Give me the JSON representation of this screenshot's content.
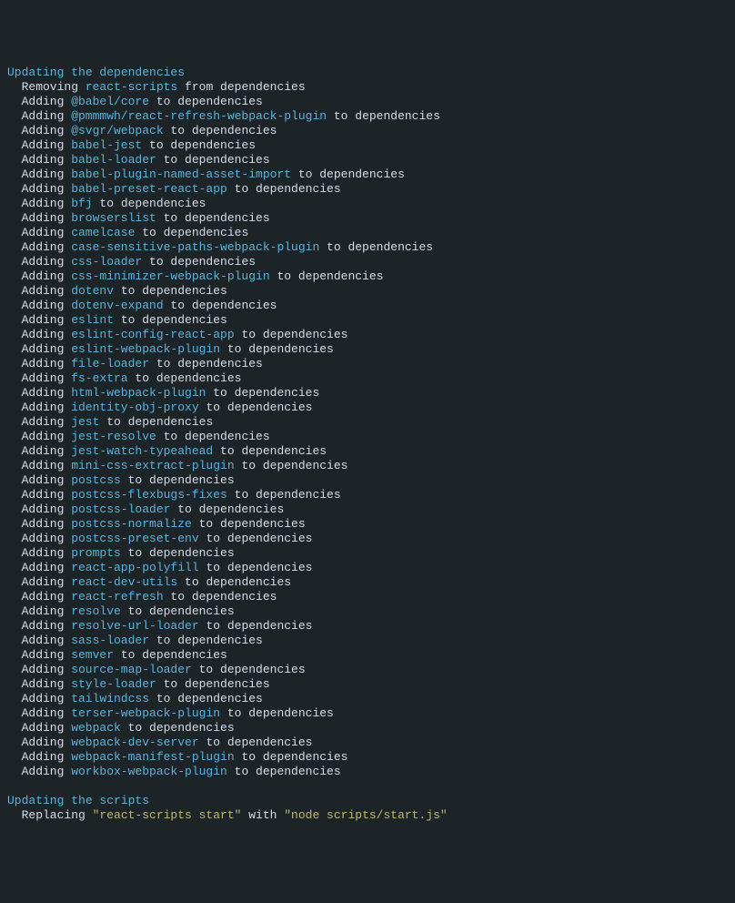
{
  "deps": {
    "header": "Updating the dependencies",
    "removing_verb": "Removing",
    "removing_pkg": "react-scripts",
    "removing_target": "from dependencies",
    "adding_verb": "Adding",
    "adding_target": "to dependencies",
    "packages": [
      "@babel/core",
      "@pmmmwh/react-refresh-webpack-plugin",
      "@svgr/webpack",
      "babel-jest",
      "babel-loader",
      "babel-plugin-named-asset-import",
      "babel-preset-react-app",
      "bfj",
      "browserslist",
      "camelcase",
      "case-sensitive-paths-webpack-plugin",
      "css-loader",
      "css-minimizer-webpack-plugin",
      "dotenv",
      "dotenv-expand",
      "eslint",
      "eslint-config-react-app",
      "eslint-webpack-plugin",
      "file-loader",
      "fs-extra",
      "html-webpack-plugin",
      "identity-obj-proxy",
      "jest",
      "jest-resolve",
      "jest-watch-typeahead",
      "mini-css-extract-plugin",
      "postcss",
      "postcss-flexbugs-fixes",
      "postcss-loader",
      "postcss-normalize",
      "postcss-preset-env",
      "prompts",
      "react-app-polyfill",
      "react-dev-utils",
      "react-refresh",
      "resolve",
      "resolve-url-loader",
      "sass-loader",
      "semver",
      "source-map-loader",
      "style-loader",
      "tailwindcss",
      "terser-webpack-plugin",
      "webpack",
      "webpack-dev-server",
      "webpack-manifest-plugin",
      "workbox-webpack-plugin"
    ]
  },
  "scripts": {
    "header": "Updating the scripts",
    "replacing_verb": "Replacing",
    "from": "\"react-scripts start\"",
    "with_word": "with",
    "to": "\"node scripts/start.js\""
  }
}
